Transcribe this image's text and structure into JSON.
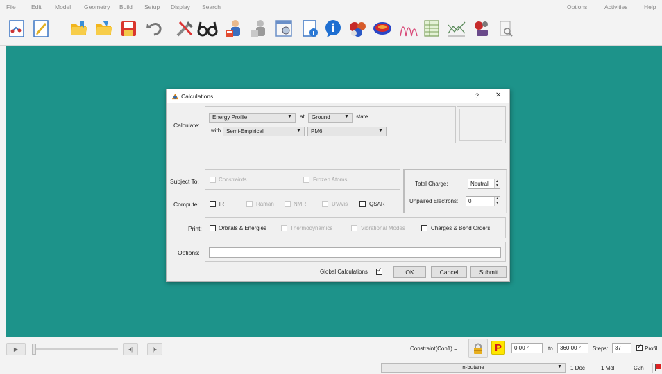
{
  "menu": {
    "left": [
      "File",
      "Edit",
      "Model",
      "Geometry",
      "Build",
      "Setup",
      "Display",
      "Search"
    ],
    "right": [
      "Options",
      "Activities",
      "Help"
    ]
  },
  "toolbar": {
    "icons": [
      "new-document-icon",
      "edit-icon",
      "open-folder-icon",
      "open-recent-icon",
      "save-icon",
      "undo-icon",
      "build-tools-icon",
      "view-glasses-icon",
      "calculations-icon",
      "guess-icon",
      "spreadsheet-icon",
      "document-info-icon",
      "chat-icon",
      "molecule-icon",
      "surface-icon",
      "spectra-icon",
      "spreadsheet-table-icon",
      "plots-icon",
      "properties-icon",
      "monitor-icon"
    ]
  },
  "dialog": {
    "title": "Calculations",
    "help": "?",
    "close": "✕",
    "calculate_label": "Calculate:",
    "calc_type": "Energy Profile",
    "at_label": "at",
    "state_value": "Ground",
    "state_label": "state",
    "with_label": "with",
    "method": "Semi-Empirical",
    "basis": "PM6",
    "subject_label": "Subject To:",
    "constraints": "Constraints",
    "frozen_atoms": "Frozen Atoms",
    "total_charge_label": "Total Charge:",
    "total_charge": "Neutral",
    "unpaired_label": "Unpaired Electrons:",
    "unpaired_value": "0",
    "compute_label": "Compute:",
    "ir": "IR",
    "raman": "Raman",
    "nmr": "NMR",
    "uvvis": "UV/vis",
    "qsar": "QSAR",
    "print_label": "Print:",
    "orbitals": "Orbitals & Energies",
    "thermo": "Thermodynamics",
    "vibrational": "Vibrational Modes",
    "charges": "Charges & Bond Orders",
    "options_label": "Options:",
    "options_value": "",
    "global_calcs": "Global Calculations",
    "ok": "OK",
    "cancel": "Cancel",
    "submit": "Submit"
  },
  "anim": {
    "play": "▶",
    "prev": "◂|",
    "next": "|▸",
    "constraint_label": "Constraint(Con1) =",
    "p_label": "P",
    "from_value": "0.00 °",
    "to_label": "to",
    "to_value": "360.00 °",
    "steps_label": "Steps:",
    "steps_value": "37",
    "profile_label": "Profil"
  },
  "status": {
    "molecule": "n-butane",
    "docs": "1 Doc",
    "mols": "1 Mol",
    "symmetry": "C2h"
  },
  "colors": {
    "workspace": "#1d938a",
    "p_button": "#ffe600"
  }
}
